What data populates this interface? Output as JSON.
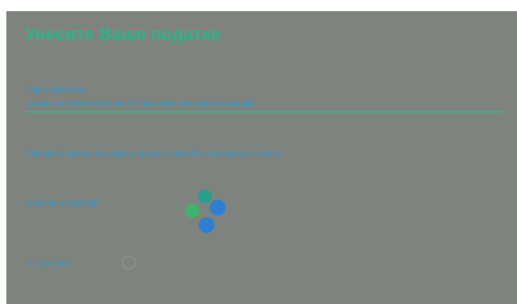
{
  "form": {
    "title": "Унесите Ваше податке",
    "username_label": "Корисничко име:",
    "username_placeholder": "(адреса електронске поште корисника након регистрације)",
    "instruction_line1": "Одобрите захтев за пријаву преко ConsentID апликације на свом",
    "instruction_line2": "мобилном уређају",
    "cancel_label": "Из захтева"
  },
  "icons": {
    "app_logo": "consentid-logo-icon",
    "loading": "loading-spinner-icon"
  },
  "colors": {
    "panel_bg": "#7f837e",
    "title": "#2bb38a",
    "text": "#2f9ad0",
    "underline": "#2cb69a",
    "logo_teal": "#2a9d8f",
    "logo_blue": "#2f7fd1",
    "logo_green": "#3fb36a"
  }
}
